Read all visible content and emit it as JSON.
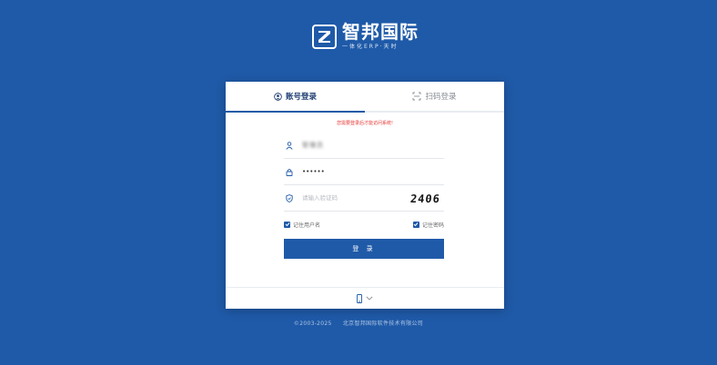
{
  "brand": {
    "name": "智邦国际",
    "slogan": "一体化ERP·天时"
  },
  "tabs": [
    {
      "label": "账号登录",
      "icon": "user-circle-icon",
      "active": true
    },
    {
      "label": "扫码登录",
      "icon": "qr-scan-icon",
      "active": false
    }
  ],
  "notice": "您需要登录后才能访问系统!",
  "form": {
    "username": "管理员",
    "password": "••••••",
    "captcha_placeholder": "请输入验证码",
    "captcha_code": "2406",
    "remember_username": "记住用户名",
    "remember_password": "记住密码",
    "login_button": "登 录"
  },
  "footer": {
    "mobile_icon": "mobile-phone-icon",
    "copyright_year": "©2003-2025",
    "company": "北京智邦国际软件技术有限公司"
  },
  "colors": {
    "background": "#1f5aa8",
    "accent": "#1f5aa8",
    "notice": "#e53935"
  }
}
